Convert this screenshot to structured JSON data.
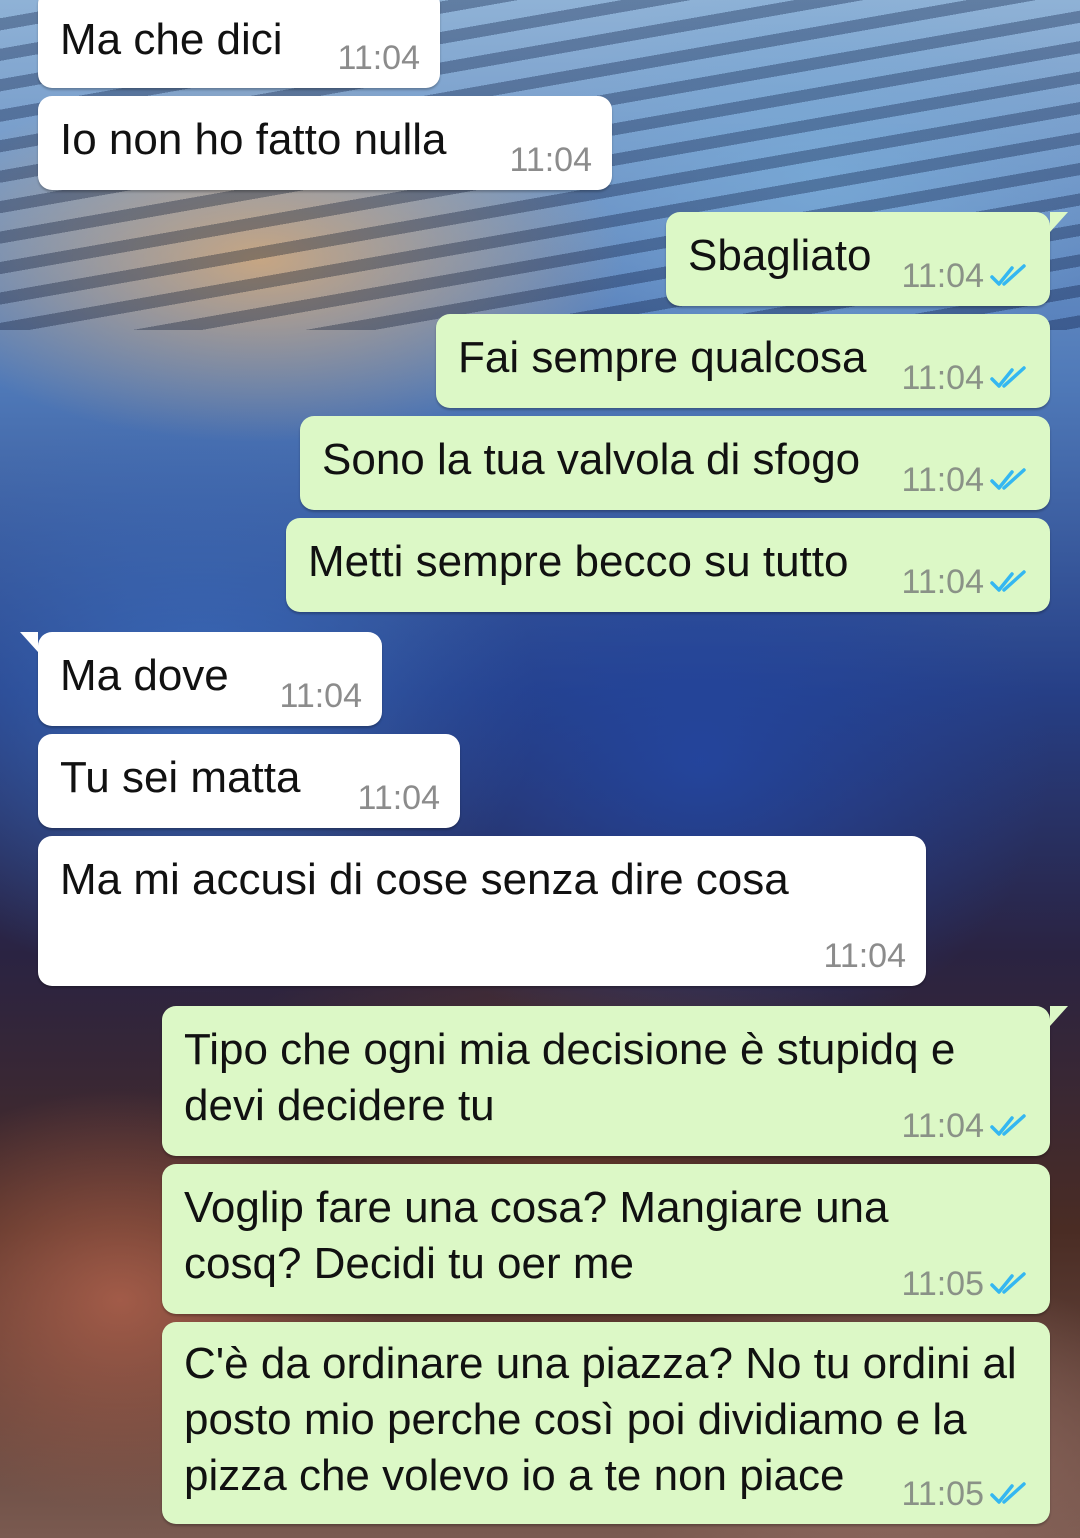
{
  "chat": {
    "colors": {
      "incoming_bubble": "#ffffff",
      "outgoing_bubble": "#dcf8c6",
      "read_ticks": "#34b7f1"
    },
    "messages": [
      {
        "dir": "in",
        "text": "Ma che dici",
        "time": "11:04"
      },
      {
        "dir": "in",
        "text": "Io non ho fatto nulla",
        "time": "11:04"
      },
      {
        "dir": "out",
        "text": "Sbagliato",
        "time": "11:04",
        "status": "read-double-check-icon"
      },
      {
        "dir": "out",
        "text": "Fai sempre qualcosa",
        "time": "11:04",
        "status": "read-double-check-icon"
      },
      {
        "dir": "out",
        "text": "Sono la tua valvola di sfogo",
        "time": "11:04",
        "status": "read-double-check-icon"
      },
      {
        "dir": "out",
        "text": "Metti sempre becco su tutto",
        "time": "11:04",
        "status": "read-double-check-icon"
      },
      {
        "dir": "in",
        "text": "Ma dove",
        "time": "11:04"
      },
      {
        "dir": "in",
        "text": "Tu sei matta",
        "time": "11:04"
      },
      {
        "dir": "in",
        "text": "Ma mi accusi di cose senza dire cosa",
        "time": "11:04"
      },
      {
        "dir": "out",
        "text": "Tipo che ogni mia decisione è stupidq e\ndevi decidere tu",
        "time": "11:04",
        "status": "read-double-check-icon"
      },
      {
        "dir": "out",
        "text": "Voglip fare una cosa? Mangiare una\ncosq? Decidi tu oer me",
        "time": "11:05",
        "status": "read-double-check-icon"
      },
      {
        "dir": "out",
        "text": "C'è da ordinare una piazza? No tu ordini al\nposto mio perche così poi dividiamo e la\npizza che volevo io a te non piace",
        "time": "11:05",
        "status": "read-double-check-icon"
      }
    ]
  }
}
